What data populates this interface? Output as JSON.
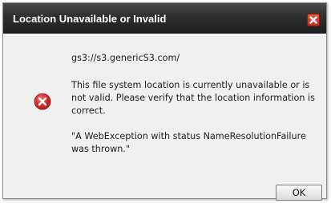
{
  "dialog": {
    "title": "Location Unavailable or Invalid",
    "close_icon": "close-icon",
    "error_icon": "error-icon",
    "path": "gs3://s3.genericS3.com/",
    "description": "This file system location is currently unavailable or is not valid. Please verify that the location information is correct.",
    "exception": "\"A WebException with status NameResolutionFailure was thrown.\"",
    "ok_label": "OK"
  },
  "colors": {
    "titlebar": "#2e2e2e",
    "close_button": "#d0301f",
    "error_icon": "#d32f2f",
    "body_background": "#f0f0f0"
  }
}
